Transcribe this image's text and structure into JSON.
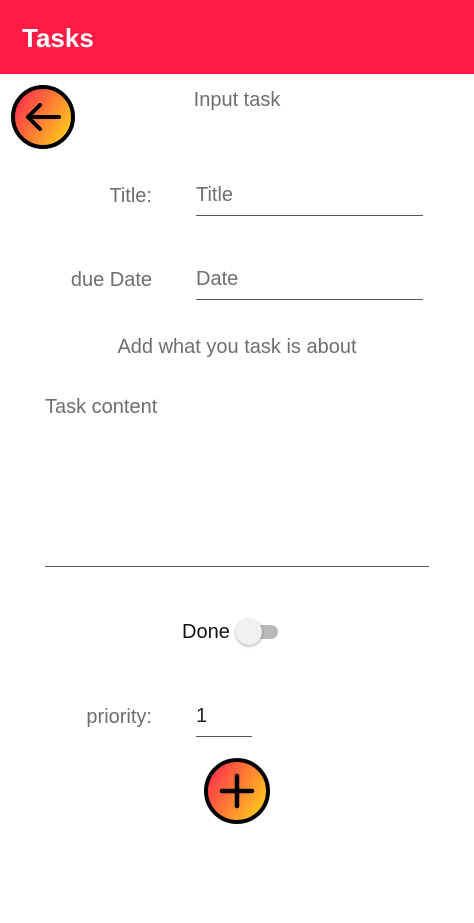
{
  "appbar": {
    "title": "Tasks",
    "color": "#ff1a43"
  },
  "back_button": {
    "icon": "arrow-left-icon"
  },
  "screen_heading": "Input task",
  "form": {
    "title_label": "Title:",
    "title_placeholder": "Title",
    "date_label": "due Date",
    "date_placeholder": "Date",
    "content_heading": "Add what you task is about",
    "content_placeholder": "Task content",
    "done_label": "Done",
    "done_checked": false,
    "priority_label": "priority:",
    "priority_value": "1"
  },
  "add_button": {
    "icon": "plus-icon"
  },
  "colors": {
    "gradient_start": "#ff2a4e",
    "gradient_end": "#ffd21a",
    "label_gray": "#6e6e6e"
  }
}
